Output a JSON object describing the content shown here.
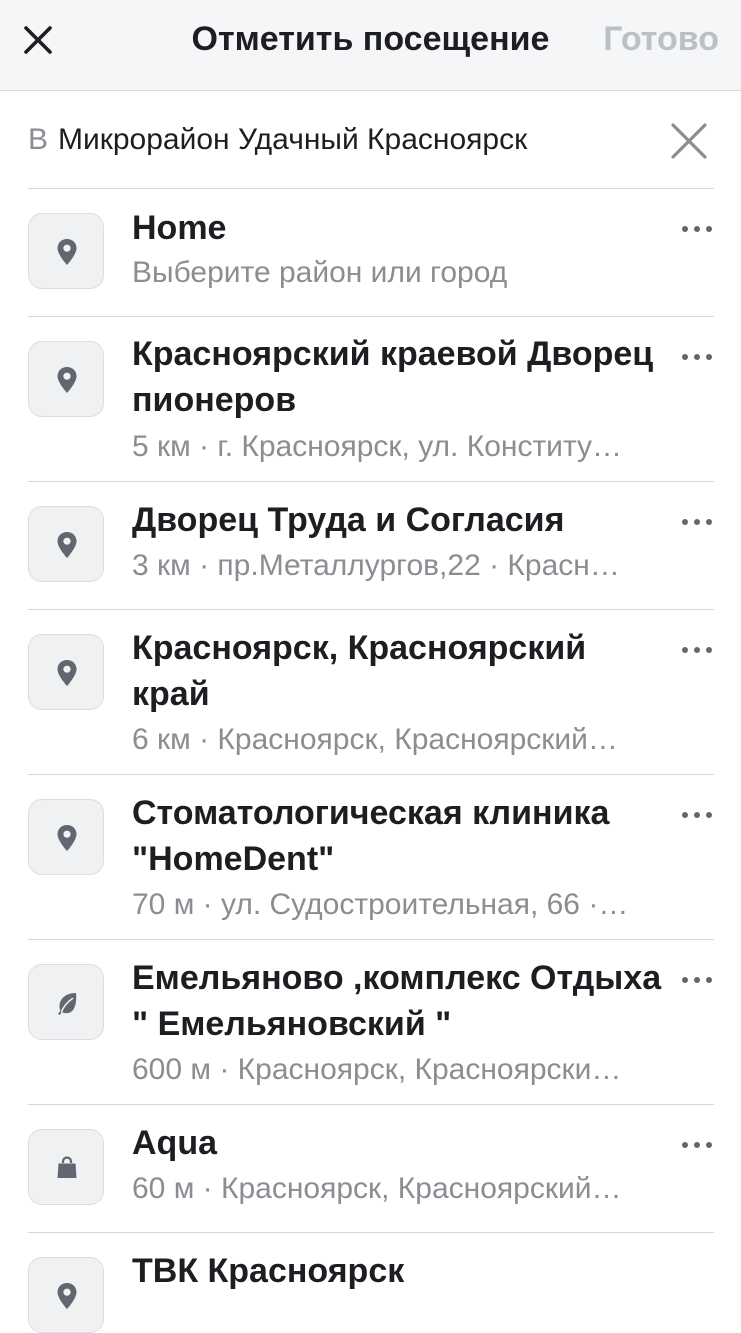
{
  "header": {
    "close_icon": "close-icon",
    "title": "Отметить посещение",
    "done_label": "Готово"
  },
  "search": {
    "prefix": "В",
    "value": "Микрорайон Удачный Красноярск",
    "clear_icon": "clear-icon"
  },
  "places": [
    {
      "icon": "location-pin-icon",
      "title": "Home",
      "subtitle": "Выберите район или город"
    },
    {
      "icon": "location-pin-icon",
      "title": "Красноярский краевой Дворец пионеров",
      "subtitle": "5 км · г. Красноярск, ул. Конститу…"
    },
    {
      "icon": "location-pin-icon",
      "title": "Дворец Труда и Согласия",
      "subtitle": "3 км · пр.Металлургов,22 · Красн…"
    },
    {
      "icon": "location-pin-icon",
      "title": "Красноярск, Красноярский край",
      "subtitle": "6 км · Красноярск, Красноярский…"
    },
    {
      "icon": "location-pin-icon",
      "title": "Стоматологическая клиника \"HomeDent\"",
      "subtitle": "70 м · ул. Судостроительная, 66 ·…"
    },
    {
      "icon": "leaf-icon",
      "title": "Емельяново ,комплекс Отдыха \" Емельяновский \"",
      "subtitle": "600 м · Красноярск, Красноярски…"
    },
    {
      "icon": "shopping-bag-icon",
      "title": "Aqua",
      "subtitle": "60 м · Красноярск, Красноярский…"
    },
    {
      "icon": "location-pin-icon",
      "title": "ТВК Красноярск",
      "subtitle": ""
    }
  ]
}
